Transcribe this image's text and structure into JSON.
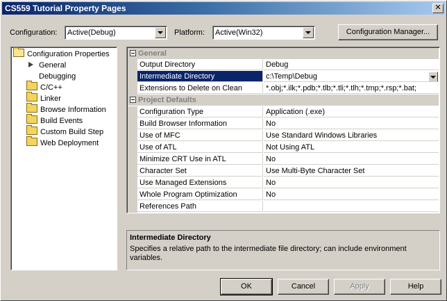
{
  "window": {
    "title": "CS559 Tutorial Property Pages"
  },
  "toolbar": {
    "configuration_label": "Configuration:",
    "configuration_value": "Active(Debug)",
    "platform_label": "Platform:",
    "platform_value": "Active(Win32)",
    "config_manager_label": "Configuration Manager..."
  },
  "tree": {
    "root": "Configuration Properties",
    "items": [
      "General",
      "Debugging",
      "C/C++",
      "Linker",
      "Browse Information",
      "Build Events",
      "Custom Build Step",
      "Web Deployment"
    ]
  },
  "grid": {
    "general": {
      "label": "General",
      "rows": [
        {
          "name": "Output Directory",
          "value": "Debug"
        },
        {
          "name": "Intermediate Directory",
          "value": "c:\\Temp\\Debug"
        },
        {
          "name": "Extensions to Delete on Clean",
          "value": "*.obj;*.ilk;*.pdb;*.tlb;*.tli;*.tlh;*.tmp;*.rsp;*.bat;"
        }
      ]
    },
    "project_defaults": {
      "label": "Project Defaults",
      "rows": [
        {
          "name": "Configuration Type",
          "value": "Application (.exe)"
        },
        {
          "name": "Build Browser Information",
          "value": "No"
        },
        {
          "name": "Use of MFC",
          "value": "Use Standard Windows Libraries"
        },
        {
          "name": "Use of ATL",
          "value": "Not Using ATL"
        },
        {
          "name": "Minimize CRT Use in ATL",
          "value": "No"
        },
        {
          "name": "Character Set",
          "value": "Use Multi-Byte Character Set"
        },
        {
          "name": "Use Managed Extensions",
          "value": "No"
        },
        {
          "name": "Whole Program Optimization",
          "value": "No"
        },
        {
          "name": "References Path",
          "value": ""
        }
      ]
    }
  },
  "description": {
    "title": "Intermediate Directory",
    "text": "Specifies a relative path to the intermediate file directory; can include environment variables."
  },
  "buttons": {
    "ok": "OK",
    "cancel": "Cancel",
    "apply": "Apply",
    "help": "Help"
  }
}
